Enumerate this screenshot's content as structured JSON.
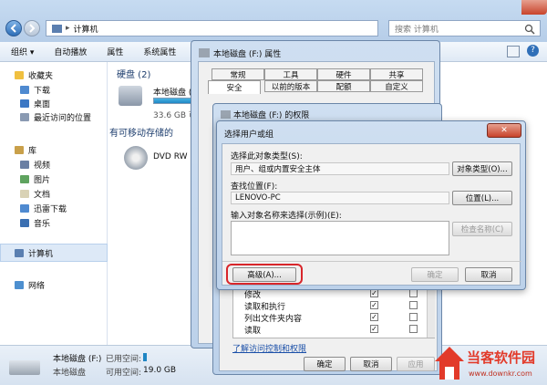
{
  "explorer": {
    "address": "计算机",
    "search_placeholder": "搜索 计算机",
    "toolbar": [
      "组织 ▾",
      "自动播放",
      "属性",
      "系统属性"
    ],
    "nav": {
      "favorites": "收藏夹",
      "download": "下载",
      "desktop": "桌面",
      "recent": "最近访问的位置",
      "library": "库",
      "video": "视频",
      "pictures": "图片",
      "docs": "文档",
      "xunlei": "迅雷下载",
      "music": "音乐",
      "computer": "计算机",
      "network": "网络"
    },
    "section_disks": "硬盘 (2)",
    "disk_label": "本地磁盘 (",
    "disk_size": "33.6 GB 可",
    "section_removable": "有可移动存储的",
    "dvd_label": "DVD RW",
    "status": {
      "name": "本地磁盘 (F:)",
      "type": "本地磁盘",
      "used_label": "已用空间:",
      "free_label": "可用空间:",
      "free_value": "19.0 GB"
    }
  },
  "properties": {
    "title": "本地磁盘 (F:) 属性",
    "tabs_row1": [
      "常规",
      "工具",
      "硬件",
      "共享"
    ],
    "tabs_row2": [
      "安全",
      "以前的版本",
      "配额",
      "自定义"
    ]
  },
  "permissions": {
    "title": "本地磁盘 (F:) 的权限",
    "perm_list": [
      "修改",
      "读取和执行",
      "列出文件夹内容",
      "读取"
    ],
    "link": "了解访问控制和权限",
    "ok": "确定",
    "cancel": "取消",
    "apply": "应用"
  },
  "select_dialog": {
    "title": "选择用户或组",
    "type_label": "选择此对象类型(S):",
    "type_value": "用户、组或内置安全主体",
    "type_button": "对象类型(O)...",
    "location_label": "查找位置(F):",
    "location_value": "LENOVO-PC",
    "location_button": "位置(L)...",
    "input_label": "输入对象名称来选择(示例)(E):",
    "check_names": "检查名称(C)",
    "advanced": "高级(A)...",
    "ok": "确定",
    "cancel": "取消"
  },
  "watermark": {
    "name": "当客软件园",
    "url": "www.downkr.com"
  },
  "colors": {
    "accent": "#1f5ea8",
    "highlight_ring": "#d8262b",
    "watermark": "#e23a2a"
  }
}
